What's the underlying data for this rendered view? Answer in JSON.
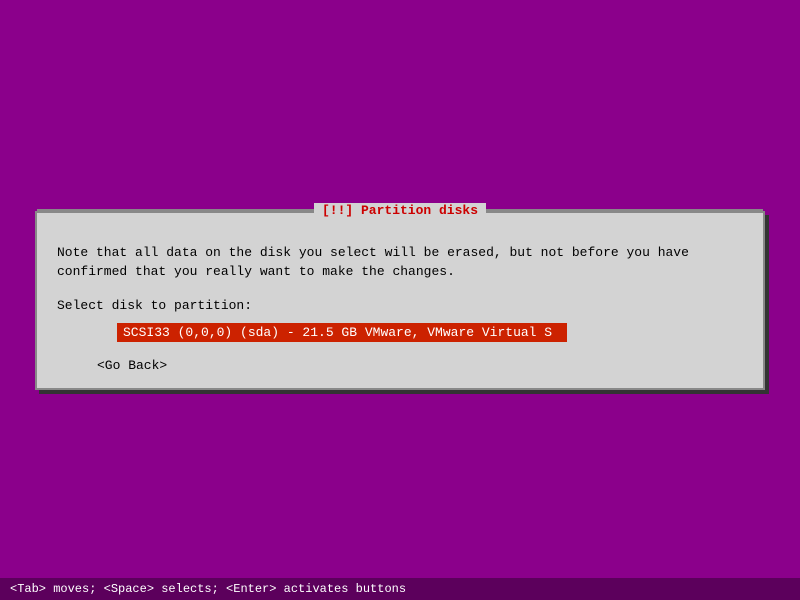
{
  "screen": {
    "background_color": "#8b008b"
  },
  "dialog": {
    "title": "[!!] Partition disks",
    "description_line1": "Note that all data on the disk you select will be erased, but not before you have",
    "description_line2": "confirmed that you really want to make the changes.",
    "select_label": "Select disk to partition:",
    "disk_item": "SCSI33 (0,0,0) (sda) - 21.5 GB VMware, VMware Virtual S",
    "go_back_label": "<Go Back>"
  },
  "status_bar": {
    "text": "<Tab> moves; <Space> selects; <Enter> activates buttons"
  }
}
